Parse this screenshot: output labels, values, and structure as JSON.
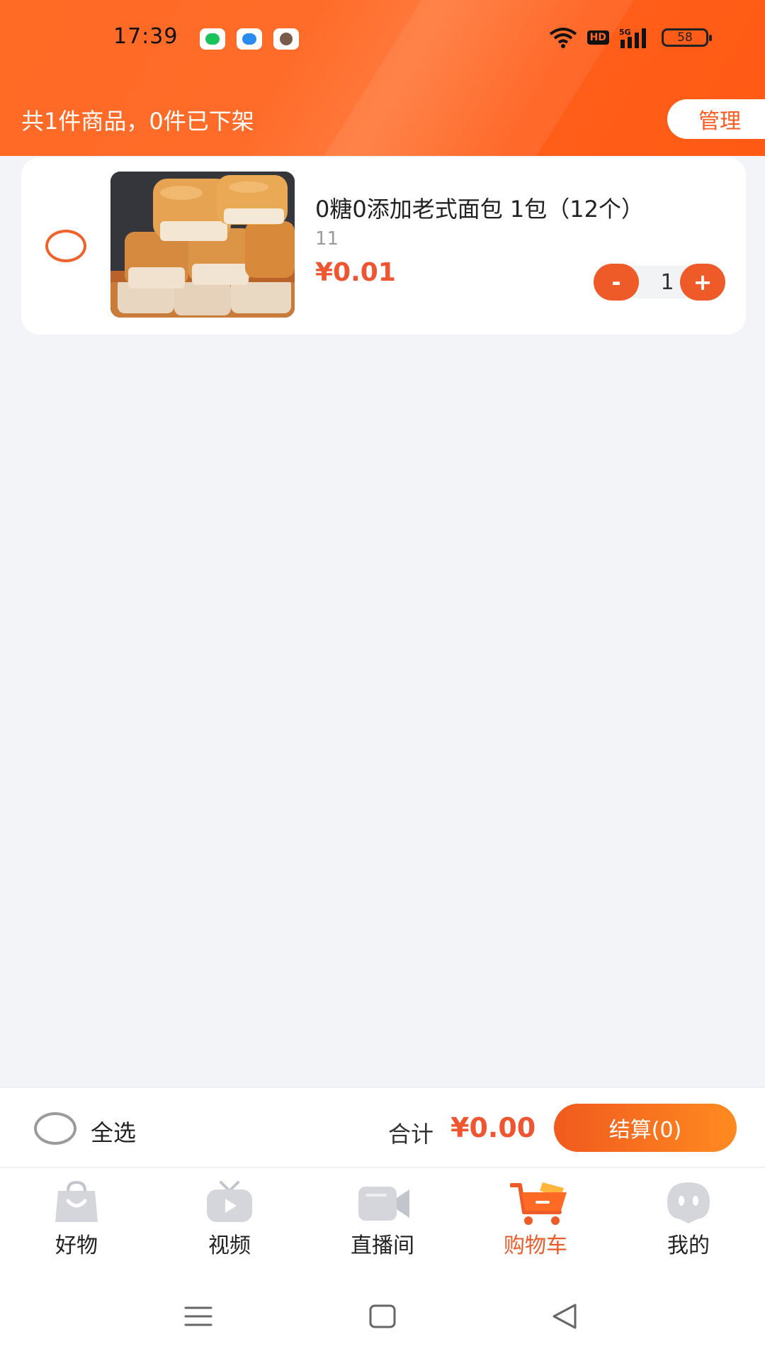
{
  "status_bar": {
    "time": "17:39",
    "notifications": [
      "message-icon",
      "search-icon",
      "avatar-icon"
    ],
    "hd_label": "HD",
    "network_label": "5G",
    "battery": "58"
  },
  "header": {
    "summary": "共1件商品，0件已下架",
    "manage_label": "管理",
    "accent_color": "#ff6a24"
  },
  "cart": {
    "items": [
      {
        "title": "0糖0添加老式面包 1包（12个）",
        "spec": "11",
        "price": "¥0.01",
        "quantity": "1",
        "minus_label": "-",
        "plus_label": "+",
        "selected": false
      }
    ]
  },
  "checkout": {
    "select_all_label": "全选",
    "total_label": "合计",
    "total_value": "¥0.00",
    "checkout_label": "结算(0)"
  },
  "tabbar": {
    "tabs": [
      {
        "label": "好物",
        "icon": "shopping-bag-icon",
        "active": false
      },
      {
        "label": "视频",
        "icon": "tv-play-icon",
        "active": false
      },
      {
        "label": "直播间",
        "icon": "video-camera-icon",
        "active": false
      },
      {
        "label": "购物车",
        "icon": "cart-icon",
        "active": true
      },
      {
        "label": "我的",
        "icon": "robot-face-icon",
        "active": false
      }
    ],
    "active_color": "#ee5a28"
  },
  "system_nav": [
    "menu-icon",
    "home-icon",
    "back-icon"
  ]
}
